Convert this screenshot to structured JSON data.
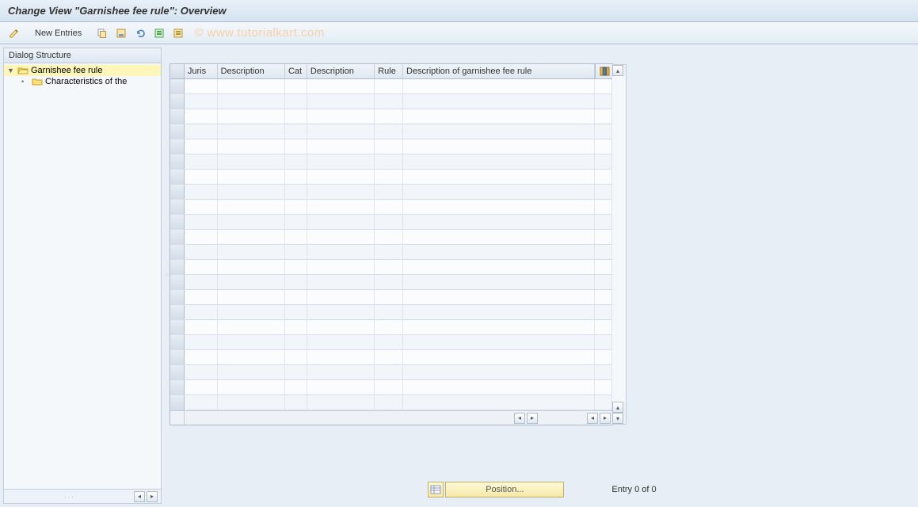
{
  "title": "Change View \"Garnishee fee rule\": Overview",
  "toolbar": {
    "new_entries": "New Entries"
  },
  "watermark": "© www.tutorialkart.com",
  "sidebar": {
    "header": "Dialog Structure",
    "items": [
      {
        "label": "Garnishee fee rule",
        "selected": true,
        "open": true
      },
      {
        "label": "Characteristics of the",
        "child": true
      }
    ]
  },
  "table": {
    "columns": {
      "juris": "Juris",
      "desc1": "Description",
      "cat": "Cat",
      "desc2": "Description",
      "rule": "Rule",
      "desc3": "Description of garnishee fee rule"
    },
    "row_count": 22
  },
  "footer": {
    "position": "Position...",
    "entry": "Entry 0 of 0"
  }
}
